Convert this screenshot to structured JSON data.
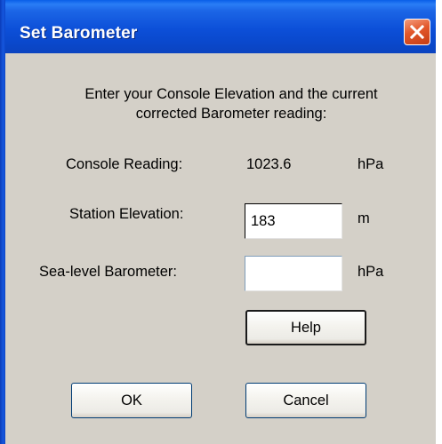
{
  "window": {
    "title": "Set Barometer"
  },
  "dialog": {
    "instructions": "Enter your Console Elevation and the current corrected Barometer reading:",
    "console_reading": {
      "label": "Console Reading:",
      "value": "1023.6",
      "unit": "hPa"
    },
    "station_elevation": {
      "label": "Station Elevation:",
      "value": "183",
      "unit": "m"
    },
    "sea_level_barometer": {
      "label": "Sea-level Barometer:",
      "value": "",
      "unit": "hPa"
    },
    "buttons": {
      "help": "Help",
      "ok": "OK",
      "cancel": "Cancel"
    }
  },
  "icons": {
    "close": "close-icon"
  },
  "colors": {
    "titlebar": "#0a48cc",
    "close_button": "#e2572b",
    "dialog_background": "#d4d0c8"
  }
}
